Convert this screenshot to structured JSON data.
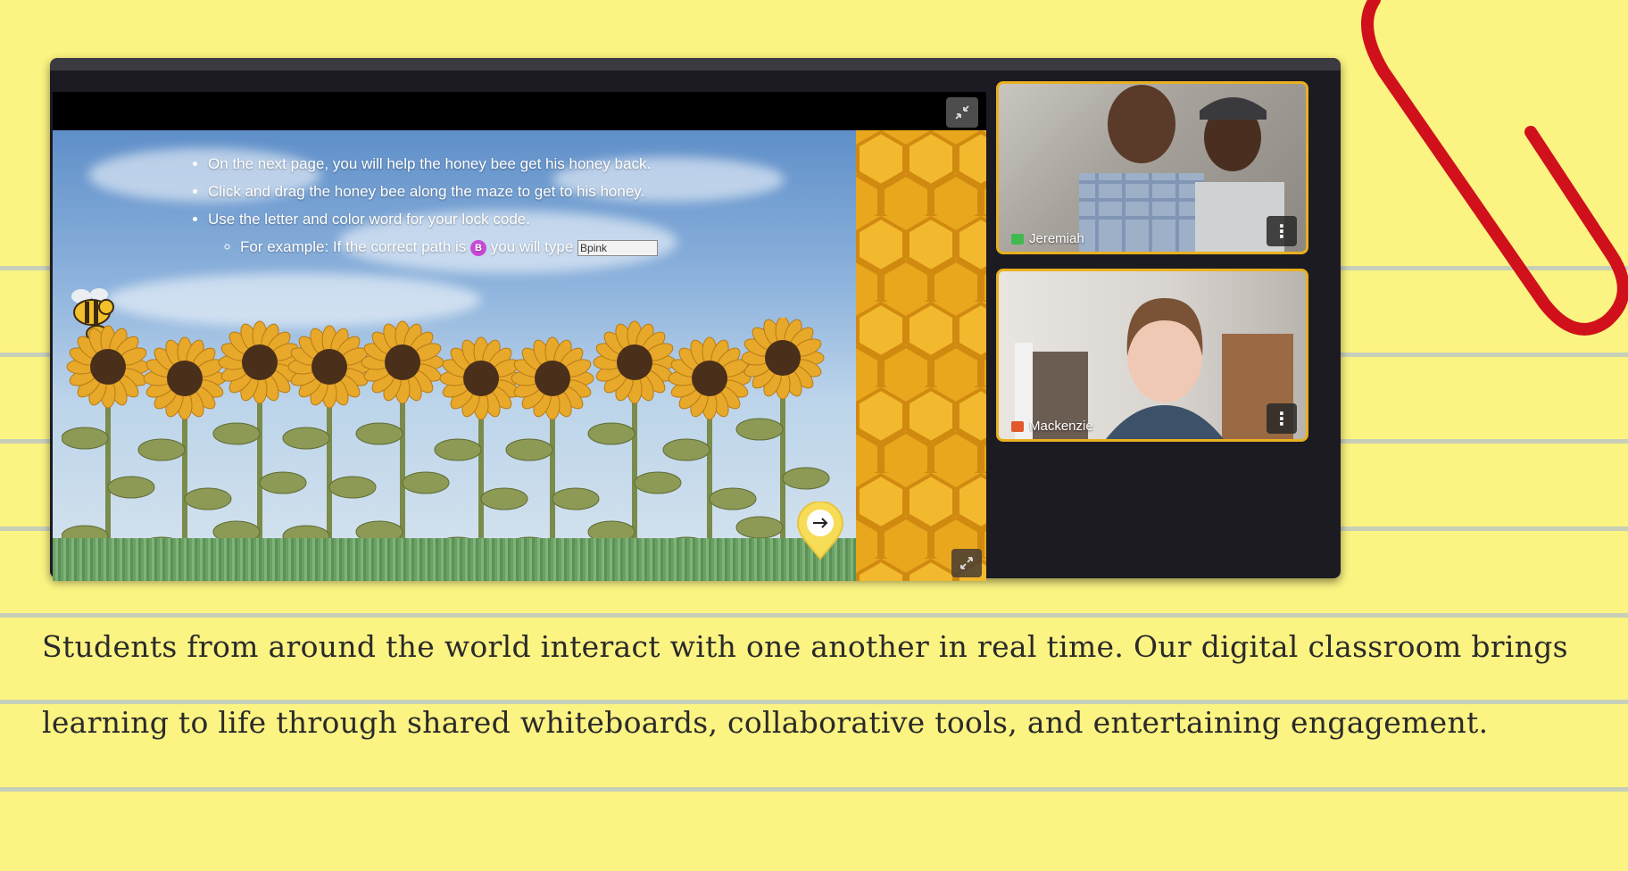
{
  "slide": {
    "instructions": [
      "On the next page, you will help the honey bee get his honey back.",
      "Click and drag the honey bee along the maze to get to his honey.",
      "Use the letter and color word for your lock code."
    ],
    "example_prefix": "For example: If the correct path is",
    "example_badge": "B",
    "example_middle": "you will type",
    "example_code": "Bpink"
  },
  "participants": [
    {
      "name": "Jeremiah",
      "mic_color": "#3fb950"
    },
    {
      "name": "Mackenzie",
      "mic_color": "#e0582c"
    }
  ],
  "caption": {
    "line1": "Students from around the world interact with one another in real time. Our digital classroom brings",
    "line2": "learning to life through shared whiteboards, collaborative tools, and entertaining engagement."
  },
  "colors": {
    "background": "#fbf382",
    "tile_border": "#e9b01f",
    "paperclip": "#d0111b"
  },
  "icons": [
    "collapse-icon",
    "expand-icon",
    "arrow-right-icon",
    "more-vertical-icon",
    "mic-icon",
    "paperclip-icon"
  ]
}
